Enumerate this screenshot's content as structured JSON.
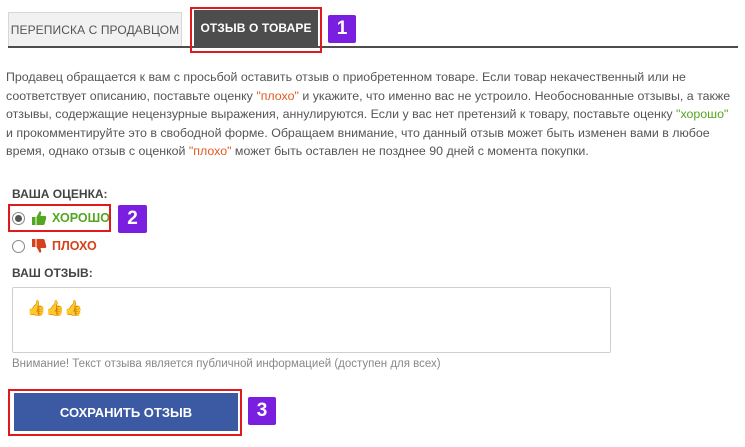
{
  "tabs": [
    {
      "label": "ПЕРЕПИСКА С ПРОДАВЦОМ"
    },
    {
      "label": "ОТЗЫВ О ТОВАРЕ"
    }
  ],
  "badges": [
    "1",
    "2",
    "3"
  ],
  "description": {
    "part1": "Продавец обращается к вам с просьбой оставить отзыв о приобретенном товаре. Если товар некачественный или не соответствует описанию, поставьте оценку ",
    "bad_word_1": "\"плохо\"",
    "part2": " и укажите, что именно вас не устроило. Необоснованные отзывы, а также отзывы, содержащие нецензурные выражения, аннулируются. Если у вас нет претензий к товару, поставьте оценку ",
    "good_word": "\"хорошо\"",
    "part3": " и прокомментируйте это в свободной форме. Обращаем внимание, что данный отзыв может быть изменен вами в любое время, однако отзыв с оценкой ",
    "bad_word_2": "\"плохо\"",
    "part4": " может быть оставлен не позднее 90 дней с момента покупки."
  },
  "rating": {
    "label": "ВАША ОЦЕНКА:",
    "good_label": "ХОРОШО",
    "bad_label": "ПЛОХО",
    "selected": "good"
  },
  "review": {
    "label": "ВАШ ОТЗЫВ:",
    "value": "👍👍👍",
    "notice": "Внимание! Текст отзыва является публичной информацией (доступен для всех)"
  },
  "save_button": "СОХРАНИТЬ ОТЗЫВ",
  "colors": {
    "highlight": "#e0191d",
    "badge": "#7a1fe0",
    "button": "#3b5aa3",
    "good": "#54a621",
    "bad": "#d5411b"
  }
}
